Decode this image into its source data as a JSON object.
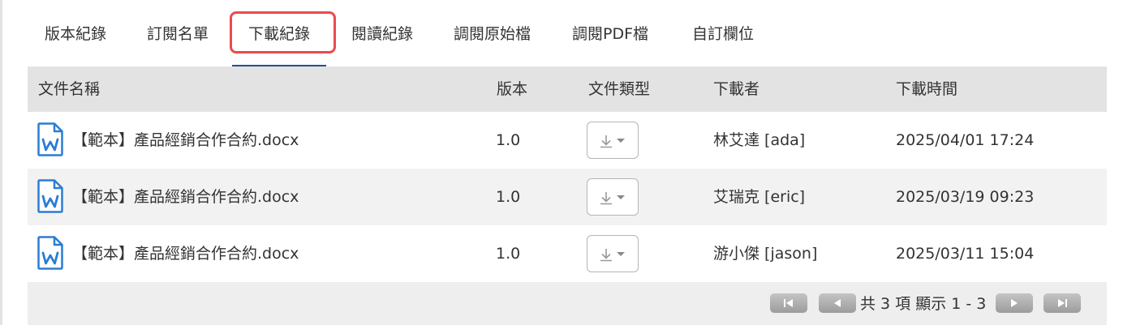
{
  "tabs": [
    {
      "label": "版本紀錄"
    },
    {
      "label": "訂閱名單"
    },
    {
      "label": "下載紀錄",
      "active": true
    },
    {
      "label": "閱讀紀錄"
    },
    {
      "label": "調閱原始檔"
    },
    {
      "label": "調閱PDF檔"
    },
    {
      "label": "自訂欄位"
    }
  ],
  "table": {
    "headers": {
      "name": "文件名稱",
      "version": "版本",
      "type": "文件類型",
      "downloader": "下載者",
      "time": "下載時間"
    },
    "rows": [
      {
        "name": "【範本】產品經銷合作合約.docx",
        "version": "1.0",
        "type_icon": "download-icon",
        "downloader": "林艾達 [ada]",
        "time": "2025/04/01 17:24"
      },
      {
        "name": "【範本】產品經銷合作合約.docx",
        "version": "1.0",
        "type_icon": "download-icon",
        "downloader": "艾瑞克 [eric]",
        "time": "2025/03/19 09:23"
      },
      {
        "name": "【範本】產品經銷合作合約.docx",
        "version": "1.0",
        "type_icon": "download-icon",
        "downloader": "游小傑 [jason]",
        "time": "2025/03/11 15:04"
      }
    ]
  },
  "pager": {
    "info": "共 3 項 顯示 1 - 3",
    "buttons": [
      "first-page-icon",
      "prev-page-icon",
      "next-page-icon",
      "last-page-icon"
    ]
  },
  "colors": {
    "active_tab_underline": "#1f4e96",
    "highlight_border": "#e94b4f",
    "header_bg": "#e3e3e3",
    "word_icon": "#2b7cd3"
  }
}
